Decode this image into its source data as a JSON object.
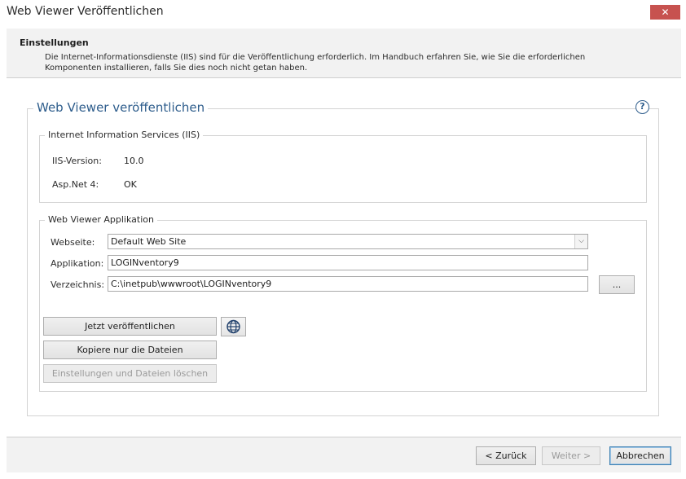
{
  "window": {
    "title": "Web Viewer Veröffentlichen",
    "close_glyph": "✕"
  },
  "header": {
    "title": "Einstellungen",
    "description": "Die Internet-Informationsdienste (IIS) sind für die Veröffentlichung erforderlich. Im Handbuch erfahren Sie, wie Sie die erforderlichen Komponenten installieren, falls Sie dies noch nicht getan haben."
  },
  "publish_group": {
    "legend": "Web Viewer veröffentlichen",
    "help_glyph": "?"
  },
  "iis_group": {
    "legend": "Internet Information Services (IIS)",
    "iis_version_label": "IIS-Version:",
    "iis_version_value": "10.0",
    "aspnet_label": "Asp.Net 4:",
    "aspnet_value": "OK"
  },
  "app_group": {
    "legend": "Web Viewer Applikation",
    "website_label": "Webseite:",
    "website_value": "Default Web Site",
    "application_label": "Applikation:",
    "application_value": "LOGINventory9",
    "directory_label": "Verzeichnis:",
    "directory_value": "C:\\inetpub\\wwwroot\\LOGINventory9",
    "browse_label": "..."
  },
  "actions": {
    "publish_now": "Jetzt veröffentlichen",
    "copy_files_only": "Kopiere nur die Dateien",
    "delete_settings_files": "Einstellungen und Dateien löschen"
  },
  "footer": {
    "back": "< Zurück",
    "next": "Weiter >",
    "cancel": "Abbrechen"
  },
  "colors": {
    "accent": "#2e5d8c",
    "close_button": "#c7524f"
  }
}
